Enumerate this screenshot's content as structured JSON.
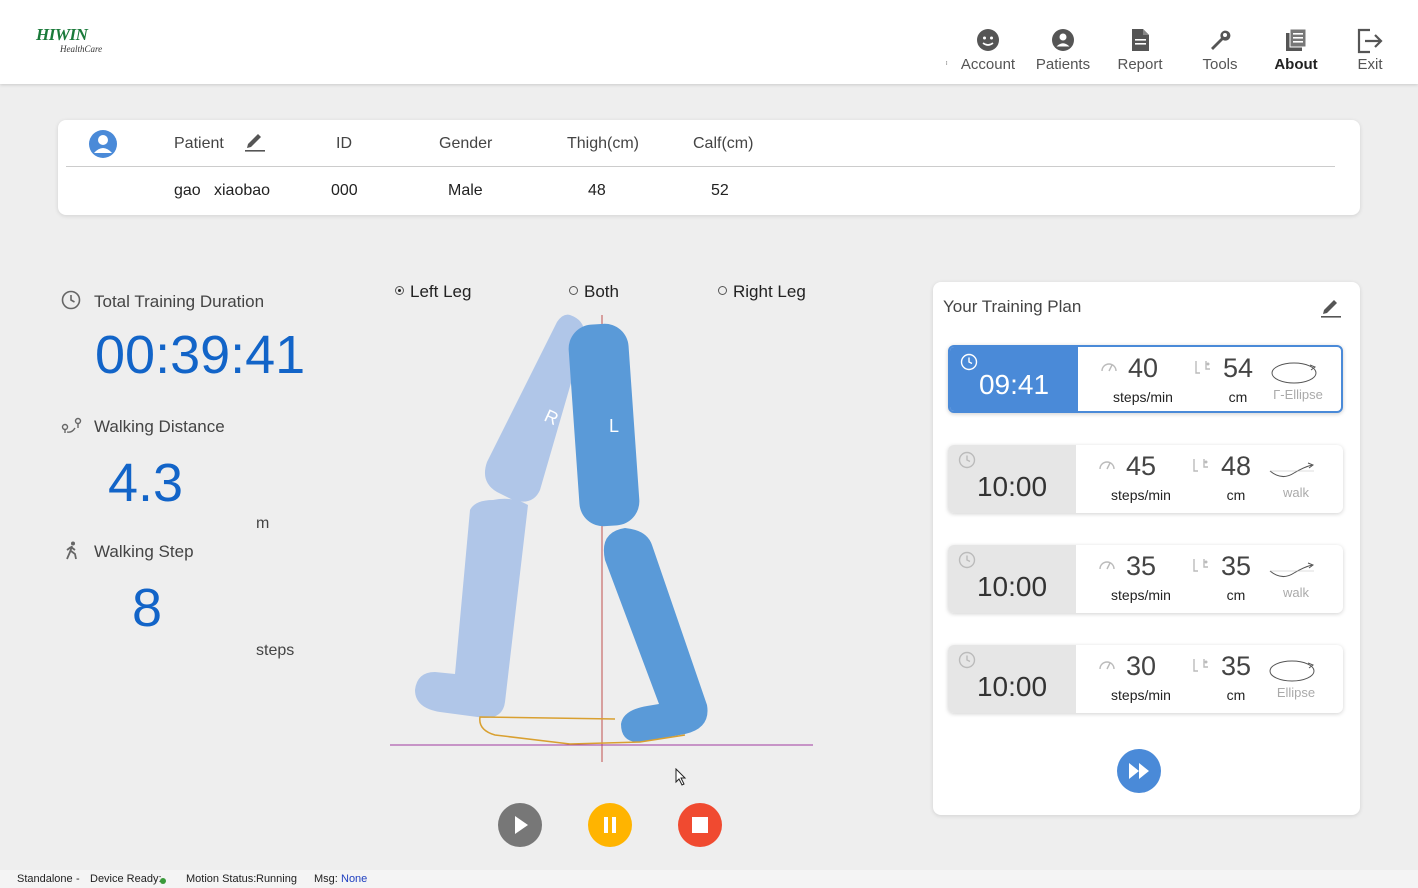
{
  "header": {
    "logo_brand": "HIWIN",
    "logo_sub": "HealthCare",
    "nav": [
      {
        "id": "account",
        "label": "Account",
        "icon": "face-icon"
      },
      {
        "id": "patients",
        "label": "Patients",
        "icon": "person-icon"
      },
      {
        "id": "report",
        "label": "Report",
        "icon": "document-icon"
      },
      {
        "id": "tools",
        "label": "Tools",
        "icon": "wrench-icon"
      },
      {
        "id": "about",
        "label": "About",
        "icon": "book-icon"
      },
      {
        "id": "exit",
        "label": "Exit",
        "icon": "exit-icon"
      }
    ],
    "active_nav": "about"
  },
  "patient": {
    "headers": [
      "Patient",
      "ID",
      "Gender",
      "Thigh(cm)",
      "Calf(cm)"
    ],
    "first_name": "gao",
    "last_name": "xiaobao",
    "id": "000",
    "gender": "Male",
    "thigh": "48",
    "calf": "52"
  },
  "stats": {
    "duration_label": "Total Training Duration",
    "duration_value": "00:39:41",
    "distance_label": "Walking Distance",
    "distance_value": "4.3",
    "distance_unit": "m",
    "steps_label": "Walking Step",
    "steps_value": "8",
    "steps_unit": "steps"
  },
  "legs": {
    "options": [
      "Left Leg",
      "Both",
      "Right Leg"
    ],
    "selected": "Left Leg",
    "left_leg_label": "L",
    "right_leg_label": "R"
  },
  "plan": {
    "title": "Your Training Plan",
    "speed_unit": "steps/min",
    "length_unit": "cm",
    "items": [
      {
        "time": "09:41",
        "speed": "40",
        "length": "54",
        "trajectory": "Γ-Ellipse",
        "active": true
      },
      {
        "time": "10:00",
        "speed": "45",
        "length": "48",
        "trajectory": "walk",
        "active": false
      },
      {
        "time": "10:00",
        "speed": "35",
        "length": "35",
        "trajectory": "walk",
        "active": false
      },
      {
        "time": "10:00",
        "speed": "30",
        "length": "35",
        "trajectory": "Ellipse",
        "active": false
      }
    ]
  },
  "colors": {
    "accent_blue": "#1264c8",
    "plan_blue": "#4a8ad8",
    "left_leg": "#5a9ad8",
    "right_leg": "#b0c6e8",
    "play": "#777777",
    "pause": "#ffb400",
    "stop": "#f04a30",
    "trajectory": "#d9a030"
  },
  "status": {
    "mode": "Standalone",
    "sep": "-",
    "device_label": "Device Ready:",
    "motion_label": "Motion Status:",
    "motion_value": "Running",
    "msg_label": "Msg:",
    "msg_value": "None"
  }
}
